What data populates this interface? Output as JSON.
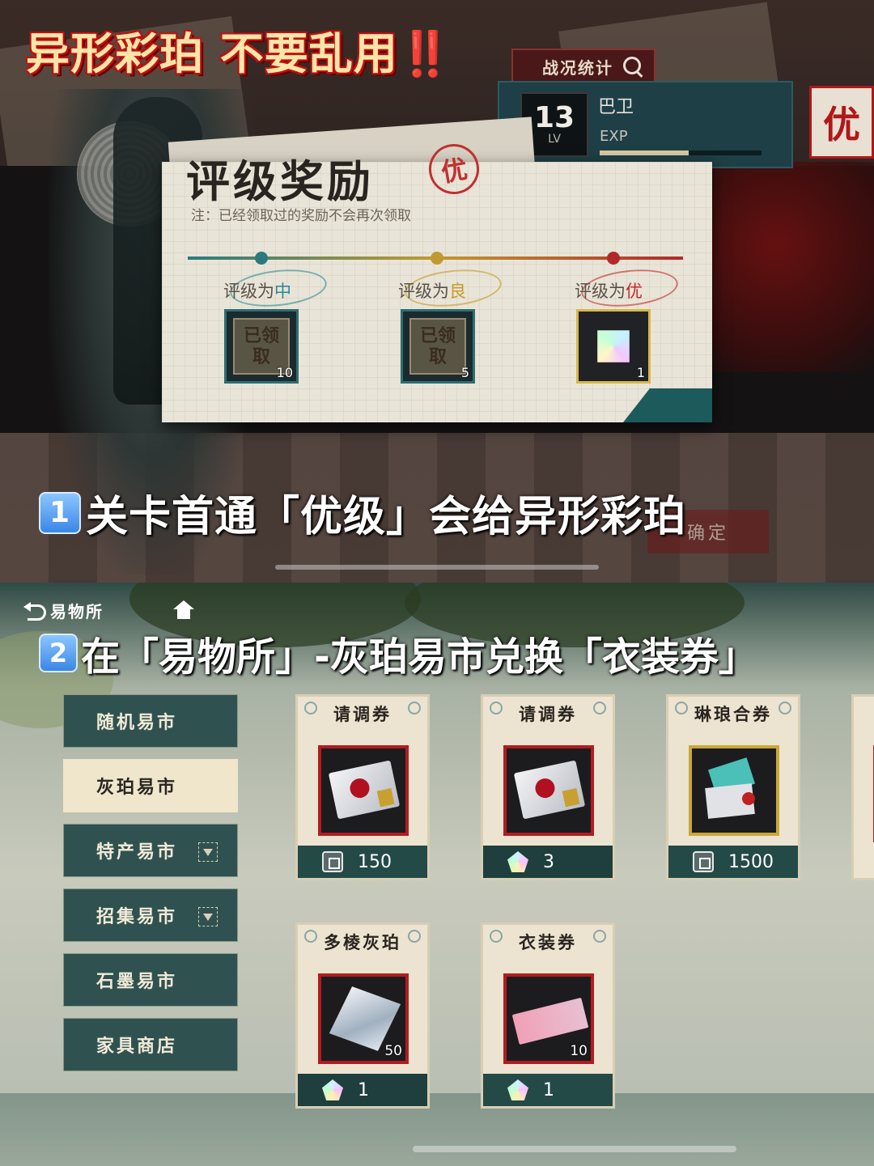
{
  "top": {
    "headline": "异形彩珀 不要乱用",
    "headline_mark": "‼️",
    "stats_tab": "战况统计",
    "player": {
      "level": "13",
      "level_label": "LV",
      "name": "巴卫",
      "exp_label": "EXP",
      "exp_progress": 0.55
    },
    "grade_seal": "优",
    "dialog": {
      "title": "评级奖励",
      "seal": "优",
      "note": "注：已经领取过的奖励不会再次领取",
      "tiers": [
        {
          "label_prefix": "评级为",
          "grade": "中",
          "grade_color": "#2a8a94",
          "claimed_text": "已领取",
          "count": "10"
        },
        {
          "label_prefix": "评级为",
          "grade": "良",
          "grade_color": "#c79a22",
          "claimed_text": "已领取",
          "count": "5"
        },
        {
          "label_prefix": "评级为",
          "grade": "优",
          "grade_color": "#c02a2a",
          "count": "1"
        }
      ]
    },
    "caption": {
      "badge": "1",
      "text": "关卡首通「优级」会给异形彩珀"
    },
    "confirm_button": "确定"
  },
  "bottom": {
    "back_label": "易物所",
    "caption": {
      "badge": "2",
      "text": "在「易物所」-灰珀易市兑换「衣装券」"
    },
    "menu": [
      {
        "label": "随机易市",
        "active": false,
        "dropdown": false
      },
      {
        "label": "灰珀易市",
        "active": true,
        "dropdown": false
      },
      {
        "label": "特产易市",
        "active": false,
        "dropdown": true
      },
      {
        "label": "招集易市",
        "active": false,
        "dropdown": true
      },
      {
        "label": "石墨易市",
        "active": false,
        "dropdown": false
      },
      {
        "label": "家具商店",
        "active": false,
        "dropdown": false
      }
    ],
    "items": [
      {
        "title": "请调券",
        "icon": "envelope-icon",
        "count": "",
        "price": "150",
        "currency": "gray-amber-icon"
      },
      {
        "title": "请调券",
        "icon": "envelope-icon",
        "count": "",
        "price": "3",
        "currency": "iridescent-amber-icon"
      },
      {
        "title": "琳琅合券",
        "icon": "ticket-bundle-icon",
        "count": "",
        "price": "1500",
        "currency": "gray-amber-icon"
      },
      {
        "title": "多棱灰珀",
        "icon": "prism-cube-icon",
        "count": "50",
        "price": "1",
        "currency": "iridescent-amber-icon"
      },
      {
        "title": "衣装券",
        "icon": "outfit-ticket-icon",
        "count": "10",
        "price": "1",
        "currency": "iridescent-amber-icon"
      }
    ]
  }
}
